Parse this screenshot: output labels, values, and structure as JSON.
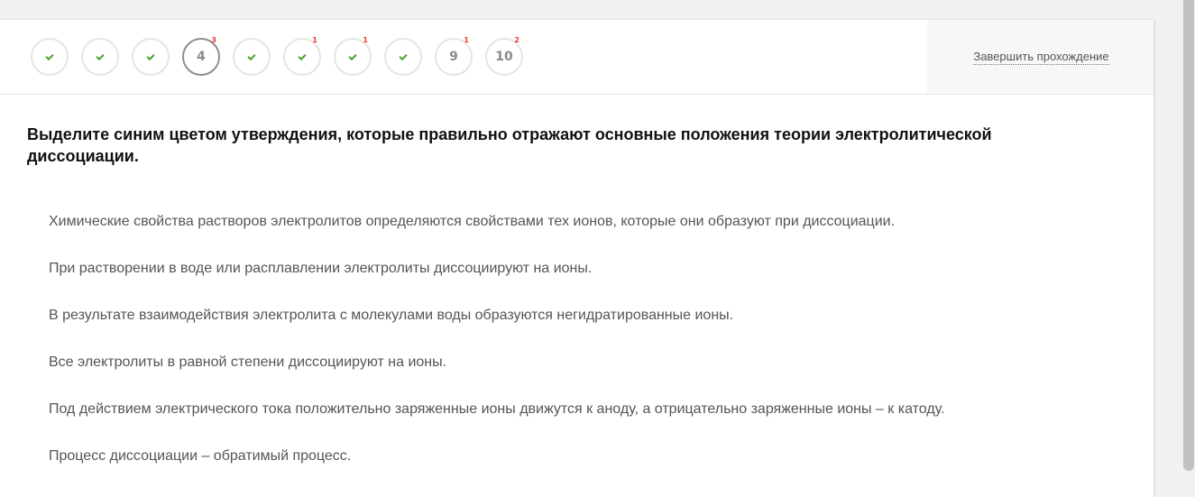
{
  "steps": [
    {
      "type": "done"
    },
    {
      "type": "done"
    },
    {
      "type": "done"
    },
    {
      "type": "current",
      "label": "4",
      "badge": "3"
    },
    {
      "type": "done"
    },
    {
      "type": "done",
      "badge": "1"
    },
    {
      "type": "done",
      "badge": "1"
    },
    {
      "type": "done"
    },
    {
      "type": "number",
      "label": "9",
      "badge": "1"
    },
    {
      "type": "number",
      "label": "10",
      "badge": "2"
    }
  ],
  "header": {
    "finish_label": "Завершить прохождение"
  },
  "question": {
    "text": "Выделите синим цветом утверждения, которые правильно отражают основные положения теории электролитической диссоциации."
  },
  "options": [
    "Химические свойства растворов электролитов определяются свойствами тех ионов, которые они образуют при диссоциации.",
    "При растворении в воде или расплавлении электролиты диссоциируют на ионы.",
    "В результате взаимодействия электролита с молекулами воды образуются негидратированные ионы.",
    "Все электролиты в равной степени диссоциируют на ионы.",
    "Под действием электрического тока положительно заряженные ионы движутся к аноду, а отрицательно заряженные ионы – к катоду.",
    "Процесс диссоциации – обратимый процесс."
  ],
  "colors": {
    "check": "#4aa32e",
    "badge": "#e53935",
    "current_border": "#8e8e8e"
  }
}
